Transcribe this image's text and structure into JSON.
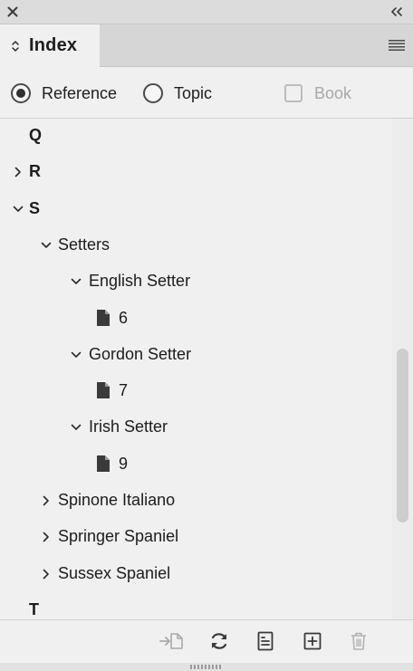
{
  "window": {
    "close_icon": "close-icon",
    "collapse_icon": "double-chevron-left-icon"
  },
  "tab": {
    "title": "Index",
    "arrows_icon": "updown-chevron-icon",
    "menu_icon": "panel-menu-icon"
  },
  "options": {
    "reference_label": "Reference",
    "topic_label": "Topic",
    "book_label": "Book",
    "selected": "Reference",
    "book_checked": false
  },
  "tree": [
    {
      "label": "Q",
      "level": 0,
      "expander": "none",
      "kind": "letter"
    },
    {
      "label": "R",
      "level": 0,
      "expander": "collapsed",
      "kind": "letter"
    },
    {
      "label": "S",
      "level": 0,
      "expander": "expanded",
      "kind": "letter"
    },
    {
      "label": "Setters",
      "level": 1,
      "expander": "expanded",
      "kind": "topic"
    },
    {
      "label": "English Setter",
      "level": 2,
      "expander": "expanded",
      "kind": "topic"
    },
    {
      "label": "6",
      "level": 3,
      "expander": "none",
      "kind": "page"
    },
    {
      "label": "Gordon Setter",
      "level": 2,
      "expander": "expanded",
      "kind": "topic"
    },
    {
      "label": "7",
      "level": 3,
      "expander": "none",
      "kind": "page"
    },
    {
      "label": "Irish Setter",
      "level": 2,
      "expander": "expanded",
      "kind": "topic"
    },
    {
      "label": "9",
      "level": 3,
      "expander": "none",
      "kind": "page"
    },
    {
      "label": "Spinone Italiano",
      "level": 1,
      "expander": "collapsed",
      "kind": "topic"
    },
    {
      "label": "Springer Spaniel",
      "level": 1,
      "expander": "collapsed",
      "kind": "topic"
    },
    {
      "label": "Sussex Spaniel",
      "level": 1,
      "expander": "collapsed",
      "kind": "topic"
    },
    {
      "label": "T",
      "level": 0,
      "expander": "none",
      "kind": "letter"
    }
  ],
  "toolbar": {
    "go_to_reference_icon": "go-to-reference-icon",
    "update_preview_icon": "refresh-icon",
    "generate_index_icon": "generate-index-icon",
    "new_entry_icon": "new-entry-icon",
    "delete_icon": "trash-icon"
  },
  "colors": {
    "panel_bg": "#f0f0f0",
    "tab_row_bg": "#d6d6d6",
    "text": "#1c1c1c",
    "disabled_text": "#a8a8a8",
    "scroll_thumb": "#cdcdcd"
  }
}
